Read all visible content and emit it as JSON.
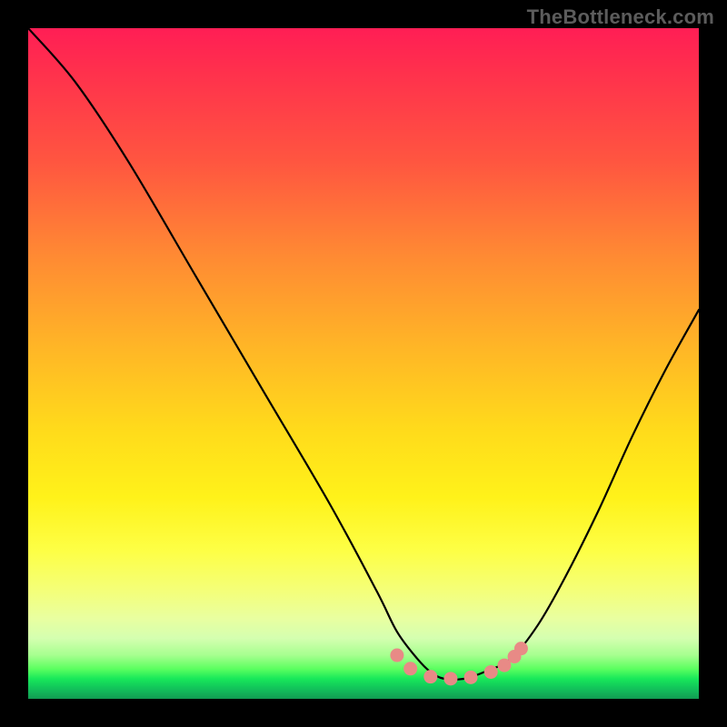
{
  "watermark": "TheBottleneck.com",
  "chart_data": {
    "type": "line",
    "title": "",
    "xlabel": "",
    "ylabel": "",
    "xlim": [
      0,
      100
    ],
    "ylim": [
      0,
      100
    ],
    "series": [
      {
        "name": "bottleneck-curve",
        "x": [
          0,
          7,
          15,
          25,
          35,
          45,
          52,
          55,
          58,
          60,
          62,
          65,
          68,
          72,
          76,
          80,
          85,
          90,
          95,
          100
        ],
        "y": [
          100,
          92,
          80,
          63,
          46,
          29,
          16,
          10,
          6,
          4,
          3,
          3,
          4,
          6,
          11,
          18,
          28,
          39,
          49,
          58
        ]
      }
    ],
    "markers": {
      "name": "valley-dots",
      "color": "#e88a86",
      "points": [
        {
          "x": 55,
          "y": 6.5
        },
        {
          "x": 57,
          "y": 4.5
        },
        {
          "x": 60,
          "y": 3.3
        },
        {
          "x": 63,
          "y": 3.0
        },
        {
          "x": 66,
          "y": 3.2
        },
        {
          "x": 69,
          "y": 4.0
        },
        {
          "x": 71,
          "y": 5.0
        },
        {
          "x": 72.5,
          "y": 6.3
        },
        {
          "x": 73.5,
          "y": 7.5
        }
      ]
    },
    "gradient_stops": [
      {
        "pos": 0.0,
        "color": "#ff1e55"
      },
      {
        "pos": 0.2,
        "color": "#ff5640"
      },
      {
        "pos": 0.48,
        "color": "#ffb726"
      },
      {
        "pos": 0.7,
        "color": "#fff21a"
      },
      {
        "pos": 0.88,
        "color": "#e9ffa0"
      },
      {
        "pos": 0.96,
        "color": "#3eff5e"
      },
      {
        "pos": 1.0,
        "color": "#119b52"
      }
    ]
  }
}
